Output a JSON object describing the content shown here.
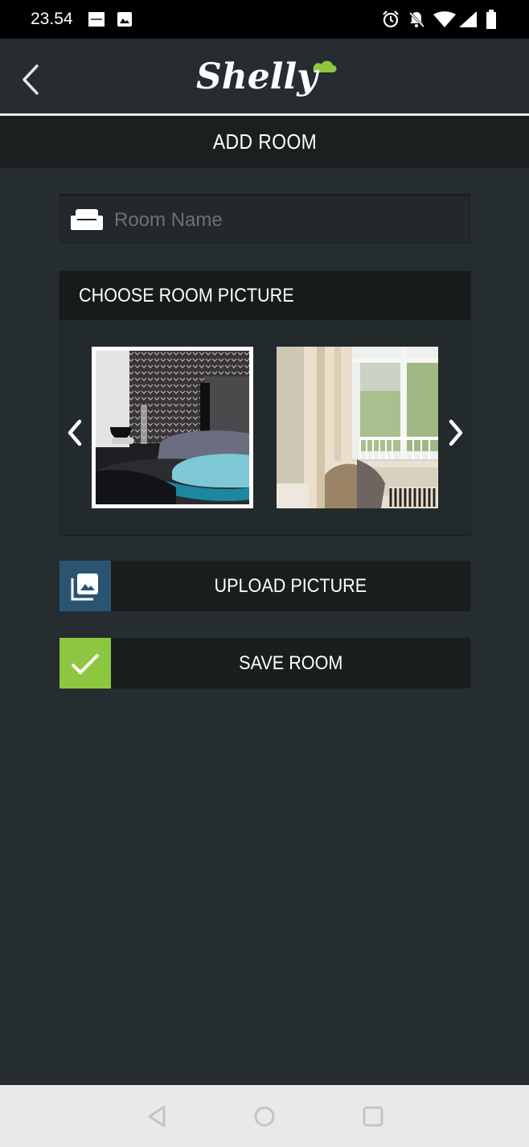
{
  "status_bar": {
    "time": "23.54",
    "left_icons": [
      "sonos-notification-icon",
      "image-notification-icon"
    ],
    "right_icons": [
      "alarm-icon",
      "notifications-off-icon",
      "wifi-icon",
      "cell-signal-icon",
      "battery-icon"
    ]
  },
  "header": {
    "back_icon": "chevron-left-icon",
    "logo_text": "Shelly",
    "logo_accent_color": "#8dc63f"
  },
  "page": {
    "title": "ADD ROOM"
  },
  "form": {
    "room_name": {
      "icon": "sofa-icon",
      "value": "",
      "placeholder": "Room Name"
    },
    "picture_chooser": {
      "title": "CHOOSE ROOM PICTURE",
      "prev_icon": "chevron-left-icon",
      "next_icon": "chevron-right-icon",
      "pictures": [
        {
          "name": "bedroom",
          "selected": true
        },
        {
          "name": "living-room",
          "selected": false
        }
      ]
    },
    "upload_button": {
      "label": "UPLOAD PICTURE",
      "icon": "photo-library-icon",
      "icon_bg": "#2b5473"
    },
    "save_button": {
      "label": "SAVE ROOM",
      "icon": "check-icon",
      "icon_bg": "#8dc63f"
    }
  },
  "nav_bar": {
    "buttons": [
      "back-triangle-icon",
      "home-circle-icon",
      "recents-square-icon"
    ]
  }
}
